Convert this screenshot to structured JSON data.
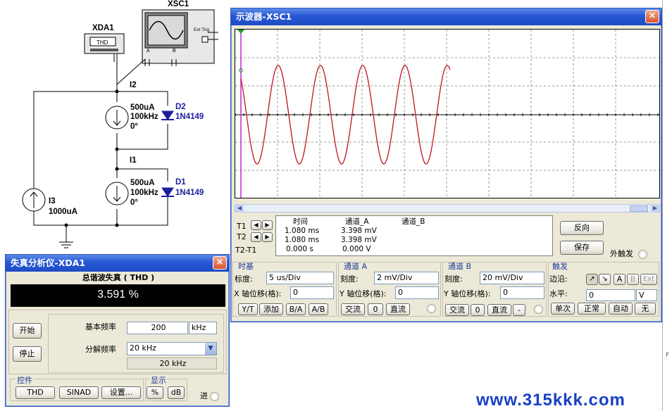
{
  "schematic": {
    "xsc1_label": "XSC1",
    "xda1_label": "XDA1",
    "xda1_screen_text": "THD",
    "ext_trig": "Ext Trig",
    "scope_ch_a": "A",
    "scope_ch_b": "B",
    "i2_label": "I2",
    "i1_label": "I1",
    "i3_label": "I3",
    "i3_value": "1000uA",
    "src2_current": "500uA",
    "src2_freq": "100kHz",
    "src2_phase": "0°",
    "src1_current": "500uA",
    "src1_freq": "100kHz",
    "src1_phase": "0°",
    "d2_name": "D2",
    "d2_part": "1N4149",
    "d1_name": "D1",
    "d1_part": "1N4149"
  },
  "oscilloscope": {
    "title": "示波器-XSC1",
    "close": "×",
    "cursors": {
      "t1": "T1",
      "t2": "T2",
      "t2_t1": "T2-T1",
      "arrow_left": "◀",
      "arrow_right": "▶"
    },
    "measure": {
      "headers": [
        "时间",
        "通道_A",
        "通道_B"
      ],
      "rows": [
        [
          "1.080 ms",
          "3.398 mV",
          ""
        ],
        [
          "1.080 ms",
          "3.398 mV",
          ""
        ],
        [
          "0.000 s",
          "0.000 V",
          ""
        ]
      ]
    },
    "reverse_button": "反向",
    "save_button": "保存",
    "ext_trigger_label": "外触发",
    "timebase": {
      "title": "时基",
      "scale_label": "标度:",
      "scale_value": "5 us/Div",
      "xpos_label": "X 轴位移(格):",
      "xpos_value": "0",
      "buttons": [
        "Y/T",
        "添加",
        "B/A",
        "A/B"
      ]
    },
    "channel_a": {
      "title": "通道 A",
      "scale_label": "刻度:",
      "scale_value": "2 mV/Div",
      "ypos_label": "Y 轴位移(格):",
      "ypos_value": "0",
      "buttons": [
        "交流",
        "0",
        "直流"
      ]
    },
    "channel_b": {
      "title": "通道 B",
      "scale_label": "刻度:",
      "scale_value": "20 mV/Div",
      "ypos_label": "Y 轴位移(格):",
      "ypos_value": "0",
      "buttons": [
        "交流",
        "0",
        "直流",
        "-"
      ]
    },
    "trigger": {
      "title": "触发",
      "edge_label": "边沿:",
      "edge_rising": "↗",
      "edge_falling": "↘",
      "src_a": "A",
      "src_b": "B",
      "src_ext": "Ext",
      "level_label": "水平:",
      "level_value": "0",
      "level_unit": "V",
      "modes": [
        "单次",
        "正常",
        "自动",
        "无"
      ]
    },
    "trace_color": "#c0141e"
  },
  "distortion": {
    "title": "失真分析仪-XDA1",
    "close": "×",
    "measure_title": "总谐波失真 ( THD )",
    "reading": "3.591 %",
    "start_button": "开始",
    "stop_button": "停止",
    "fundamental_label": "基本频率",
    "fundamental_value": "200",
    "fundamental_unit": "kHz",
    "resolution_label": "分解频率",
    "resolution_value": "20 kHz",
    "resolution_display": "20 kHz",
    "controls_title": "控件",
    "control_buttons": [
      "THD",
      "SINAD",
      "设置..."
    ],
    "display_title": "显示",
    "display_buttons": [
      "%",
      "dB"
    ],
    "side_label": "进"
  },
  "watermark": "www.315kkk.com",
  "edge_label": "F"
}
